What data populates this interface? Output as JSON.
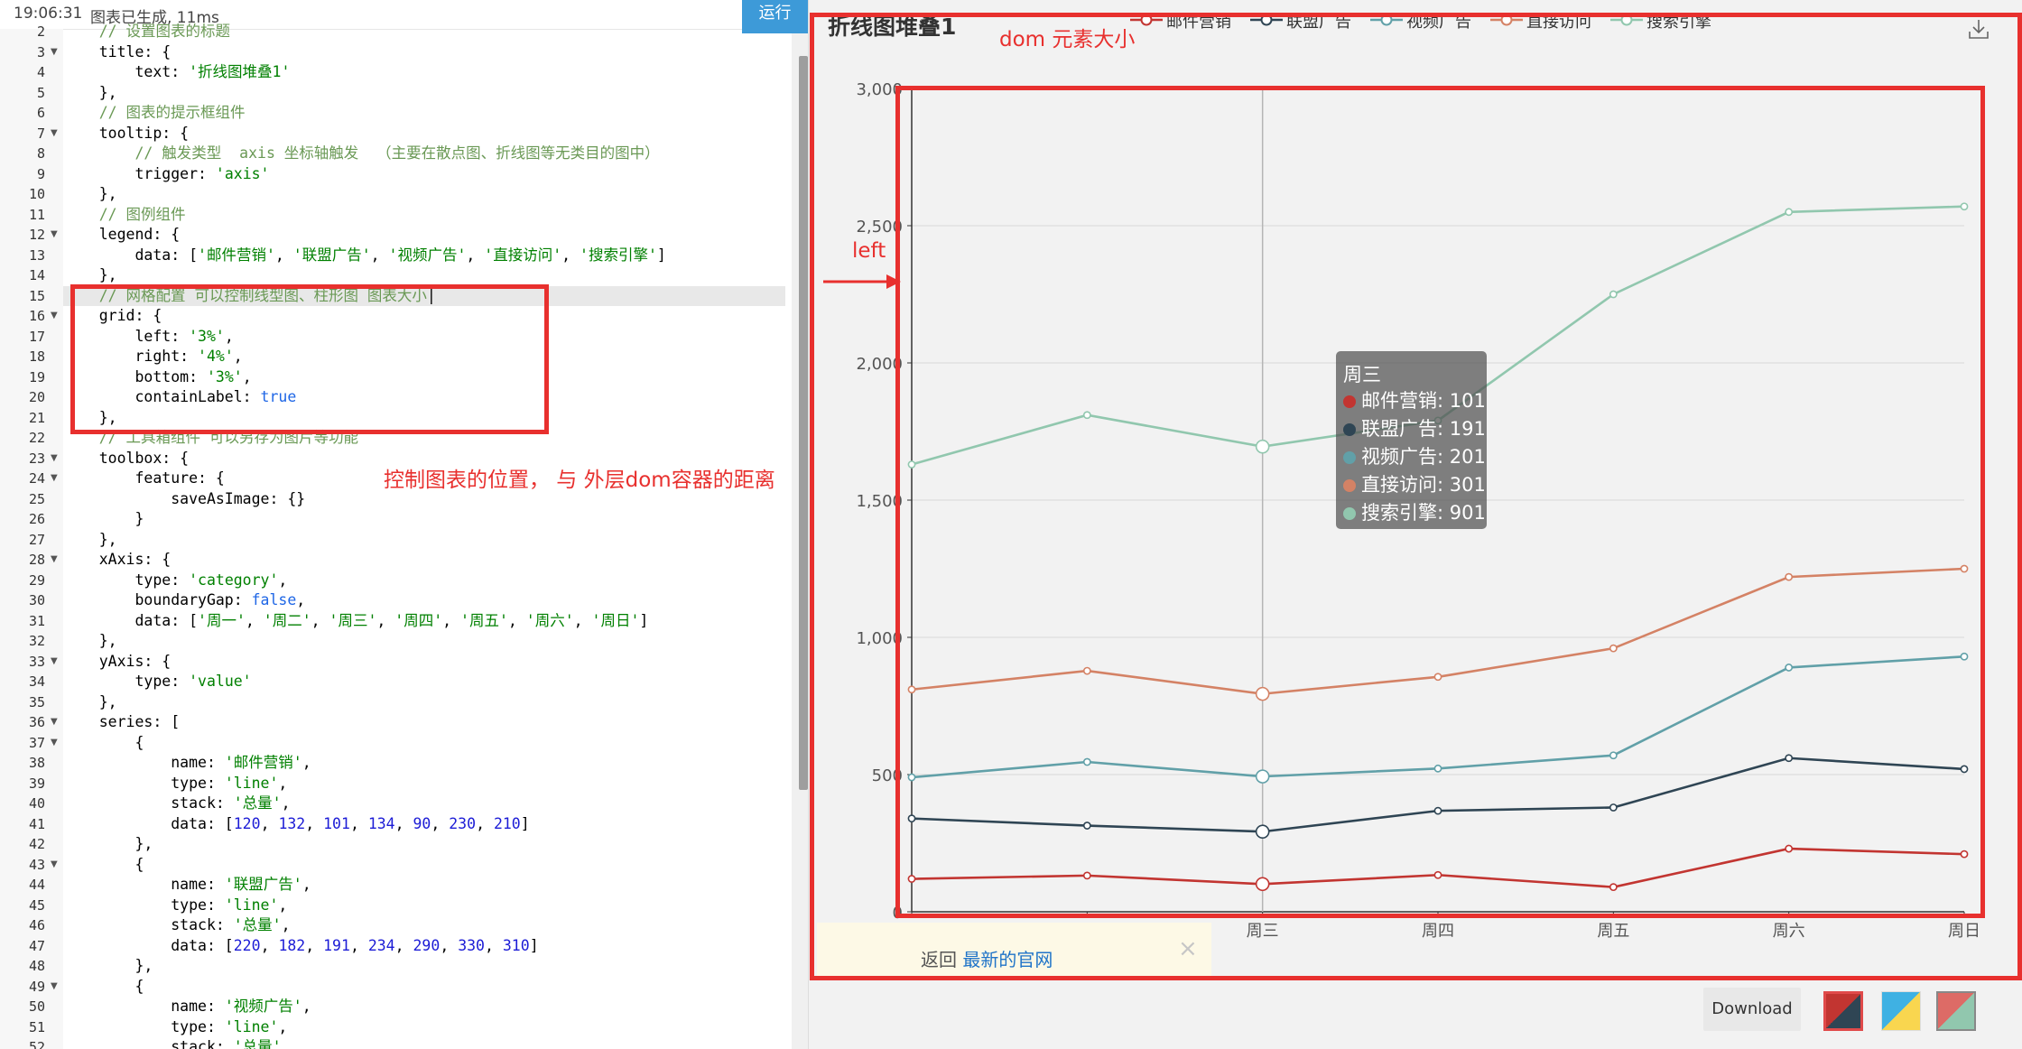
{
  "toolbar": {
    "time": "19:06:31",
    "status": "图表已生成, 11ms",
    "run_label": "运行"
  },
  "editor": {
    "lines": [
      {
        "n": "2",
        "fold": false,
        "html": "<span class=\"c-cm\">    // 设置图表的标题</span>"
      },
      {
        "n": "3",
        "fold": true,
        "html": "    title: {"
      },
      {
        "n": "4",
        "fold": false,
        "html": "        text: <span class=\"c-str\">'折线图堆叠1'</span>"
      },
      {
        "n": "5",
        "fold": false,
        "html": "    },"
      },
      {
        "n": "6",
        "fold": false,
        "html": "<span class=\"c-cm\">    // 图表的提示框组件</span>"
      },
      {
        "n": "7",
        "fold": true,
        "html": "    tooltip: {"
      },
      {
        "n": "8",
        "fold": false,
        "html": "<span class=\"c-cm\">        // 触发类型  axis 坐标轴触发  （主要在散点图、折线图等无类目的图中）</span>"
      },
      {
        "n": "9",
        "fold": false,
        "html": "        trigger: <span class=\"c-str\">'axis'</span>"
      },
      {
        "n": "10",
        "fold": false,
        "html": "    },"
      },
      {
        "n": "11",
        "fold": false,
        "html": "<span class=\"c-cm\">    // 图例组件</span>"
      },
      {
        "n": "12",
        "fold": true,
        "html": "    legend: {"
      },
      {
        "n": "13",
        "fold": false,
        "html": "        data: [<span class=\"c-str\">'邮件营销'</span>, <span class=\"c-str\">'联盟广告'</span>, <span class=\"c-str\">'视频广告'</span>, <span class=\"c-str\">'直接访问'</span>, <span class=\"c-str\">'搜索引擎'</span>]"
      },
      {
        "n": "14",
        "fold": false,
        "html": "    },"
      },
      {
        "n": "15",
        "fold": false,
        "html": "<span class=\"c-cm\">    // 网格配置 可以控制线型图、柱形图 图表大小</span>|"
      },
      {
        "n": "16",
        "fold": true,
        "html": "    grid: {"
      },
      {
        "n": "17",
        "fold": false,
        "html": "        left: <span class=\"c-str\">'3%'</span>,"
      },
      {
        "n": "18",
        "fold": false,
        "html": "        right: <span class=\"c-str\">'4%'</span>,"
      },
      {
        "n": "19",
        "fold": false,
        "html": "        bottom: <span class=\"c-str\">'3%'</span>,"
      },
      {
        "n": "20",
        "fold": false,
        "html": "        containLabel: <span class=\"c-kw\">true</span>"
      },
      {
        "n": "21",
        "fold": false,
        "html": "    },"
      },
      {
        "n": "22",
        "fold": false,
        "html": "<span class=\"c-cm\">    // 工具箱组件 可以另存为图片等功能</span>"
      },
      {
        "n": "23",
        "fold": true,
        "html": "    toolbox: {"
      },
      {
        "n": "24",
        "fold": true,
        "html": "        feature: {"
      },
      {
        "n": "25",
        "fold": false,
        "html": "            saveAsImage: {}"
      },
      {
        "n": "26",
        "fold": false,
        "html": "        }"
      },
      {
        "n": "27",
        "fold": false,
        "html": "    },"
      },
      {
        "n": "28",
        "fold": true,
        "html": "    xAxis: {"
      },
      {
        "n": "29",
        "fold": false,
        "html": "        type: <span class=\"c-str\">'category'</span>,"
      },
      {
        "n": "30",
        "fold": false,
        "html": "        boundaryGap: <span class=\"c-kw\">false</span>,"
      },
      {
        "n": "31",
        "fold": false,
        "html": "        data: [<span class=\"c-str\">'周一'</span>, <span class=\"c-str\">'周二'</span>, <span class=\"c-str\">'周三'</span>, <span class=\"c-str\">'周四'</span>, <span class=\"c-str\">'周五'</span>, <span class=\"c-str\">'周六'</span>, <span class=\"c-str\">'周日'</span>]"
      },
      {
        "n": "32",
        "fold": false,
        "html": "    },"
      },
      {
        "n": "33",
        "fold": true,
        "html": "    yAxis: {"
      },
      {
        "n": "34",
        "fold": false,
        "html": "        type: <span class=\"c-str\">'value'</span>"
      },
      {
        "n": "35",
        "fold": false,
        "html": "    },"
      },
      {
        "n": "36",
        "fold": true,
        "html": "    series: ["
      },
      {
        "n": "37",
        "fold": true,
        "html": "        {"
      },
      {
        "n": "38",
        "fold": false,
        "html": "            name: <span class=\"c-str\">'邮件营销'</span>,"
      },
      {
        "n": "39",
        "fold": false,
        "html": "            type: <span class=\"c-str\">'line'</span>,"
      },
      {
        "n": "40",
        "fold": false,
        "html": "            stack: <span class=\"c-str\">'总量'</span>,"
      },
      {
        "n": "41",
        "fold": false,
        "html": "            data: [<span class=\"c-num\">120</span>, <span class=\"c-num\">132</span>, <span class=\"c-num\">101</span>, <span class=\"c-num\">134</span>, <span class=\"c-num\">90</span>, <span class=\"c-num\">230</span>, <span class=\"c-num\">210</span>]"
      },
      {
        "n": "42",
        "fold": false,
        "html": "        },"
      },
      {
        "n": "43",
        "fold": true,
        "html": "        {"
      },
      {
        "n": "44",
        "fold": false,
        "html": "            name: <span class=\"c-str\">'联盟广告'</span>,"
      },
      {
        "n": "45",
        "fold": false,
        "html": "            type: <span class=\"c-str\">'line'</span>,"
      },
      {
        "n": "46",
        "fold": false,
        "html": "            stack: <span class=\"c-str\">'总量'</span>,"
      },
      {
        "n": "47",
        "fold": false,
        "html": "            data: [<span class=\"c-num\">220</span>, <span class=\"c-num\">182</span>, <span class=\"c-num\">191</span>, <span class=\"c-num\">234</span>, <span class=\"c-num\">290</span>, <span class=\"c-num\">330</span>, <span class=\"c-num\">310</span>]"
      },
      {
        "n": "48",
        "fold": false,
        "html": "        },"
      },
      {
        "n": "49",
        "fold": true,
        "html": "        {"
      },
      {
        "n": "50",
        "fold": false,
        "html": "            name: <span class=\"c-str\">'视频广告'</span>,"
      },
      {
        "n": "51",
        "fold": false,
        "html": "            type: <span class=\"c-str\">'line'</span>,"
      },
      {
        "n": "52",
        "fold": false,
        "html": "            stack: <span class=\"c-str\">'总量'</span>,"
      }
    ],
    "active_line": "15"
  },
  "annotations": {
    "code_note": "控制图表的位置， 与 外层dom容器的距离",
    "dom_note": "dom 元素大小",
    "left_note": "left"
  },
  "chart_data": {
    "type": "line",
    "title": "折线图堆叠1",
    "categories": [
      "周一",
      "周二",
      "周三",
      "周四",
      "周五",
      "周六",
      "周日"
    ],
    "stacked": true,
    "ylim": [
      0,
      3000
    ],
    "yticks": [
      "0",
      "500",
      "1,000",
      "1,500",
      "2,000",
      "2,500",
      "3,000"
    ],
    "grid": true,
    "legend_position": "top-center",
    "series": [
      {
        "name": "邮件营销",
        "color": "#c23531",
        "values": [
          120,
          132,
          101,
          134,
          90,
          230,
          210
        ]
      },
      {
        "name": "联盟广告",
        "color": "#2f4554",
        "values": [
          220,
          182,
          191,
          234,
          290,
          330,
          310
        ]
      },
      {
        "name": "视频广告",
        "color": "#61a0a8",
        "values": [
          150,
          232,
          201,
          154,
          190,
          330,
          410
        ]
      },
      {
        "name": "直接访问",
        "color": "#d48265",
        "values": [
          320,
          332,
          301,
          334,
          390,
          330,
          320
        ]
      },
      {
        "name": "搜索引擎",
        "color": "#91c7ae",
        "values": [
          820,
          932,
          901,
          934,
          1290,
          1330,
          1320
        ]
      }
    ],
    "hover_category_index": 2
  },
  "tooltip": {
    "title": "周三",
    "rows": [
      {
        "text": "邮件营销: 101",
        "color": "#c23531"
      },
      {
        "text": "联盟广告: 191",
        "color": "#2f4554"
      },
      {
        "text": "视频广告: 201",
        "color": "#61a0a8"
      },
      {
        "text": "直接访问: 301",
        "color": "#d48265"
      },
      {
        "text": "搜索引擎: 901",
        "color": "#91c7ae"
      }
    ]
  },
  "notice": {
    "prefix": "返回 ",
    "link": "最新的官网",
    "close": "×"
  },
  "footer": {
    "download_label": "Download"
  }
}
